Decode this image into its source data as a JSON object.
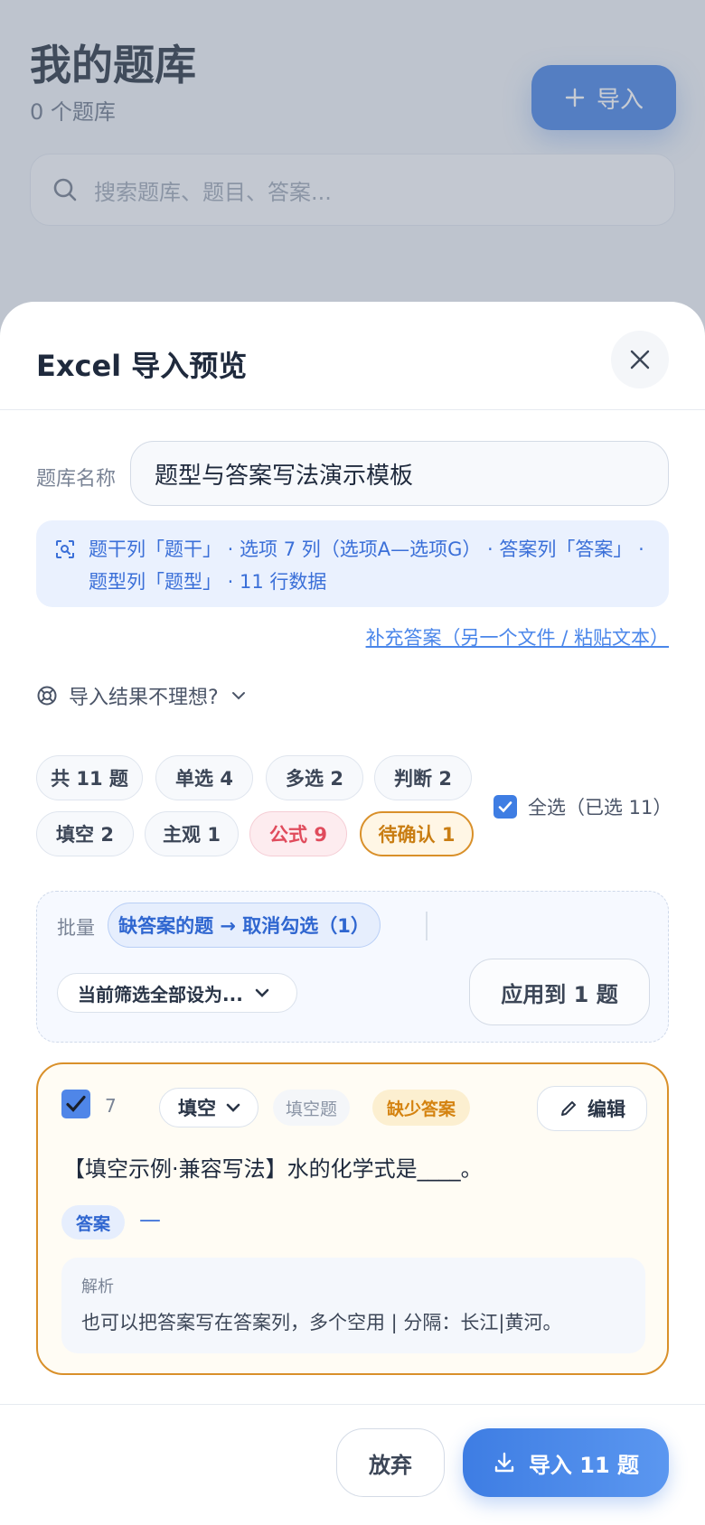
{
  "background": {
    "title": "我的题库",
    "subtitle": "0 个题库",
    "import_label": "导入",
    "search_placeholder": "搜索题库、题目、答案..."
  },
  "sheet": {
    "title": "Excel 导入预览",
    "bank_name_label": "题库名称",
    "bank_name_value": "题型与答案写法演示模板",
    "detect_info": "题干列「题干」 · 选项 7 列（选项A—选项G） · 答案列「答案」 · 题型列「题型」 · 11 行数据",
    "supplement_link": "补充答案（另一个文件 / 粘贴文本）",
    "help_text": "导入结果不理想?",
    "chips": [
      {
        "label": "共 11 题"
      },
      {
        "label": "单选 4"
      },
      {
        "label": "多选 2"
      },
      {
        "label": "判断 2"
      },
      {
        "label": "填空 2"
      },
      {
        "label": "主观 1"
      },
      {
        "label": "公式 9"
      },
      {
        "label": "待确认 1"
      }
    ],
    "select_all_label": "全选（已选 11）",
    "batch": {
      "label": "批量",
      "chip": "缺答案的题 → 取消勾选（1）",
      "select_value": "当前筛选全部设为...",
      "apply_label": "应用到 1 题"
    },
    "card": {
      "number": "7",
      "type_value": "填空",
      "type_tag": "填空题",
      "warn_tag": "缺少答案",
      "edit_label": "编辑",
      "question": "【填空示例·兼容写法】水的化学式是____。",
      "answer_label": "答案",
      "answer_value": "—",
      "explanation_label": "解析",
      "explanation_text": "也可以把答案写在答案列，多个空用 | 分隔：长江|黄河。"
    },
    "footer": {
      "discard_label": "放弃",
      "import_label": "导入 11 题"
    }
  },
  "colors": {
    "accent": "#3e7de3",
    "warning": "#d9902a",
    "danger": "#e04b5c"
  }
}
